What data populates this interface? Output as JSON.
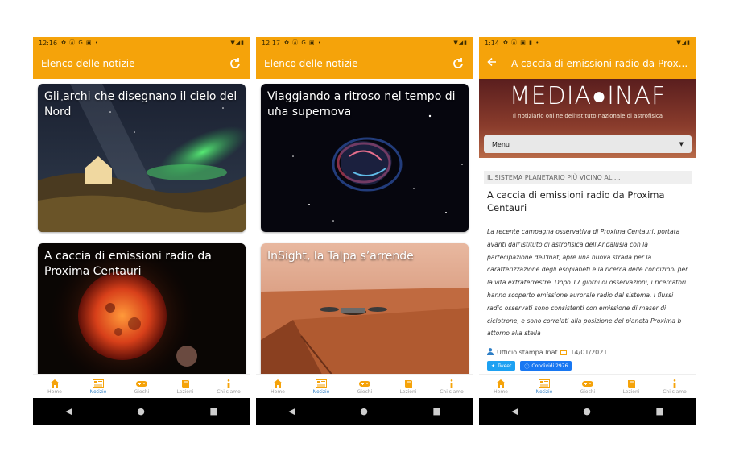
{
  "screens": [
    {
      "status": {
        "time": "12:16",
        "icons": "✿ Ⓐ G ▣ •",
        "right": "▼◢▮"
      },
      "appbar": {
        "title": "Elenco delle notizie"
      },
      "cards": [
        {
          "title": "Gli archi che disegnano il cielo del Nord"
        },
        {
          "title": "A caccia di emissioni radio da Proxima Centauri"
        }
      ]
    },
    {
      "status": {
        "time": "12:17",
        "icons": "✿ Ⓐ G ▣ •",
        "right": "▼◢▮"
      },
      "appbar": {
        "title": "Elenco delle notizie"
      },
      "cards": [
        {
          "title": "Viaggiando a ritroso nel tempo di una supernova"
        },
        {
          "title": "InSight, la Talpa s’arrende"
        }
      ]
    },
    {
      "status": {
        "time": "1:14",
        "icons": "✿ Ⓐ ▣ ▮ •",
        "right": "▼◢▮"
      },
      "appbar": {
        "title": "A caccia di emissioni radio da Prox..."
      },
      "banner": {
        "logo": "MEDIA●INAF",
        "tagline": "Il notiziario online dell'Istituto nazionale di astrofisica",
        "menu": "Menu"
      },
      "breadcrumb": "IL SISTEMA PLANETARIO PIÙ VICINO AL ...",
      "article_title": "A caccia di emissioni radio da Proxima Centauri",
      "article_body": "La recente campagna osservativa di Proxima Centauri, portata avanti dall'istituto di astrofisica dell'Andalusia con la partecipazione dell'Inaf, apre una nuova strada per la caratterizzazione degli esopianeti e la ricerca delle condizioni per la vita extraterrestre. Dopo 17 giorni di osservazioni, i ricercatori hanno scoperto emissione aurorale radio dal sistema. I flussi radio osservati sono consistenti con emissione di maser di ciclotrone, e sono correlati alla posizione del pianeta Proxima b attorno alla stella",
      "author": "Ufficio stampa Inaf",
      "date": "14/01/2021",
      "tweet": "Tweet",
      "share": "Condividi 2976"
    }
  ],
  "nav": {
    "items": [
      "Home",
      "Notizie",
      "Giochi",
      "Lezioni",
      "Chi siamo"
    ],
    "active": "Notizie"
  },
  "colors": {
    "accent": "#f5a30a",
    "active_nav": "#2f7fc6"
  }
}
